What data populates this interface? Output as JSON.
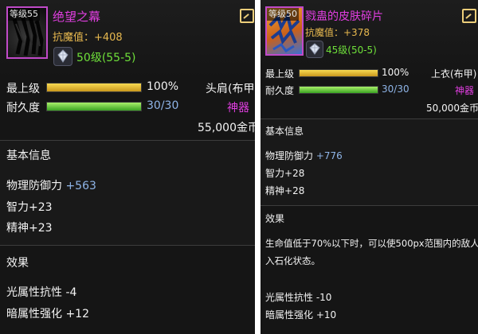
{
  "left": {
    "level_badge": "等级55",
    "name": "绝望之幕",
    "resist": "抗魔值：+408",
    "gem_label": "50级(55-5)",
    "min_level_label": "最上级",
    "durability_label": "耐久度",
    "grade_percent": "100%",
    "durability_value": "30/30",
    "slot": "头肩(布甲)",
    "rarity": "神器",
    "price": "55,000金币",
    "basic_info_title": "基本信息",
    "stats": [
      {
        "name": "物理防御力",
        "value": "+563"
      },
      {
        "name": "智力",
        "value": "+23"
      },
      {
        "name": "精神",
        "value": "+23"
      }
    ],
    "effect_title": "效果",
    "effects": [
      "光属性抗性 -4",
      "暗属性强化 +12"
    ]
  },
  "right": {
    "level_badge": "等级50",
    "name": "戮蛊的皮肤碎片",
    "resist": "抗魔值：+378",
    "gem_label": "45级(50-5)",
    "min_level_label": "最上级",
    "durability_label": "耐久度",
    "grade_percent": "100%",
    "durability_value": "30/30",
    "slot": "上衣(布甲)",
    "rarity": "神器",
    "price": "50,000金币",
    "basic_info_title": "基本信息",
    "stats": [
      {
        "name": "物理防御力",
        "value": "+776"
      },
      {
        "name": "智力",
        "value": "+28"
      },
      {
        "name": "精神",
        "value": "+28"
      }
    ],
    "effect_title": "效果",
    "effect_desc_line1": "生命值低于70%以下时，可以使500px范围内的敌人进",
    "effect_desc_line2": "入石化状态。",
    "effects": [
      "光属性抗性 -10",
      "暗属性强化 +10"
    ]
  },
  "bars": {
    "grade_fill": 1.0,
    "durability_fill": 1.0
  },
  "colors": {
    "name_purple": "#e03ee0",
    "resist_gold": "#e8b94f",
    "gem_green": "#6fe03a",
    "stat_blue": "#8fb5e8",
    "rarity_magenta": "#e03ee0"
  },
  "icons": [
    "item-thumbnail",
    "gem-icon",
    "share-icon"
  ]
}
